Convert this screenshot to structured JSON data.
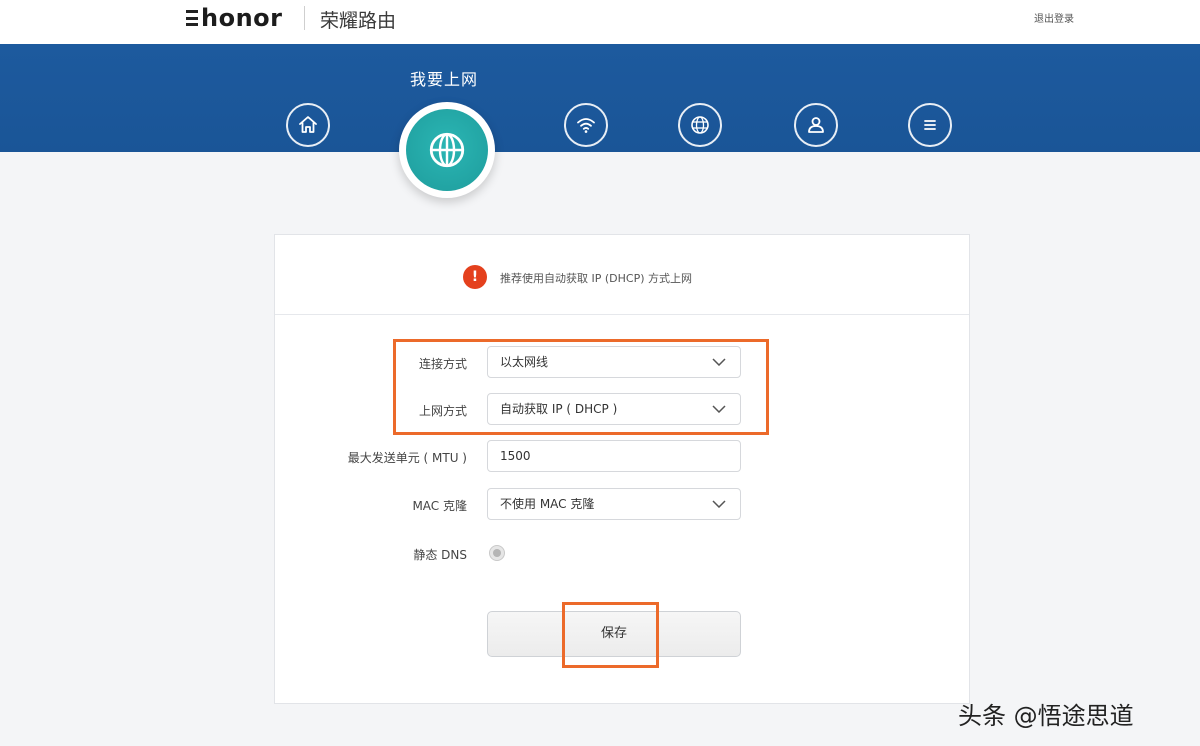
{
  "header": {
    "brand": "honor",
    "product_name": "荣耀路由",
    "logout": "退出登录"
  },
  "nav": {
    "active_title": "我要上网",
    "items": [
      {
        "icon": "home-icon"
      },
      {
        "icon": "globe-icon",
        "active": true
      },
      {
        "icon": "wifi-icon"
      },
      {
        "icon": "network-globe-icon"
      },
      {
        "icon": "user-icon"
      },
      {
        "icon": "menu-icon"
      }
    ]
  },
  "tip": {
    "icon": "!",
    "text": "推荐使用自动获取 IP (DHCP) 方式上网"
  },
  "form": {
    "connection_type": {
      "label": "连接方式",
      "value": "以太网线"
    },
    "internet_mode": {
      "label": "上网方式",
      "value": "自动获取 IP ( DHCP )"
    },
    "mtu": {
      "label": "最大发送单元 ( MTU )",
      "value": "1500"
    },
    "mac_clone": {
      "label": "MAC 克隆",
      "value": "不使用 MAC 克隆"
    },
    "static_dns": {
      "label": "静态 DNS",
      "enabled": false
    }
  },
  "save_label": "保存",
  "watermark": "头条 @悟途思道",
  "colors": {
    "nav_blue": "#1a5597",
    "active_teal": "#22a8a8",
    "highlight_orange": "#ec6a2a",
    "alert_red": "#e4401d"
  }
}
